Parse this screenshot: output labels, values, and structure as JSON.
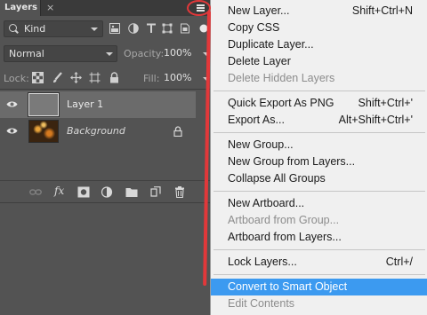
{
  "panel": {
    "tab_title": "Layers",
    "tab_close": "×",
    "filter": {
      "kind_label": "Kind"
    },
    "blend": {
      "mode": "Normal",
      "opacity_label": "Opacity:",
      "opacity_value": "100%"
    },
    "lock": {
      "label": "Lock:",
      "fill_label": "Fill:",
      "fill_value": "100%"
    },
    "layers": [
      {
        "name": "Layer 1",
        "selected": true,
        "visible": true
      },
      {
        "name": "Background",
        "selected": false,
        "visible": true,
        "locked": true
      }
    ],
    "bottom_fx": "fx"
  },
  "menu": {
    "items": [
      {
        "label": "New Layer...",
        "shortcut": "Shift+Ctrl+N",
        "disabled": false
      },
      {
        "label": "Copy CSS",
        "shortcut": "",
        "disabled": false
      },
      {
        "label": "Duplicate Layer...",
        "shortcut": "",
        "disabled": false
      },
      {
        "label": "Delete Layer",
        "shortcut": "",
        "disabled": false
      },
      {
        "label": "Delete Hidden Layers",
        "shortcut": "",
        "disabled": true
      },
      {
        "label": "Quick Export As PNG",
        "shortcut": "Shift+Ctrl+'",
        "disabled": false
      },
      {
        "label": "Export As...",
        "shortcut": "Alt+Shift+Ctrl+'",
        "disabled": false
      },
      {
        "label": "New Group...",
        "shortcut": "",
        "disabled": false
      },
      {
        "label": "New Group from Layers...",
        "shortcut": "",
        "disabled": false
      },
      {
        "label": "Collapse All Groups",
        "shortcut": "",
        "disabled": false
      },
      {
        "label": "New Artboard...",
        "shortcut": "",
        "disabled": false
      },
      {
        "label": "Artboard from Group...",
        "shortcut": "",
        "disabled": true
      },
      {
        "label": "Artboard from Layers...",
        "shortcut": "",
        "disabled": false
      },
      {
        "label": "Lock Layers...",
        "shortcut": "Ctrl+/",
        "disabled": false
      },
      {
        "label": "Convert to Smart Object",
        "shortcut": "",
        "disabled": false,
        "highlighted": true
      },
      {
        "label": "Edit Contents",
        "shortcut": "",
        "disabled": true
      }
    ]
  },
  "colors": {
    "panel_bg": "#535353",
    "menu_bg": "#f0f0f0",
    "highlight": "#3c9af0",
    "annotation_red": "#e2383a"
  }
}
